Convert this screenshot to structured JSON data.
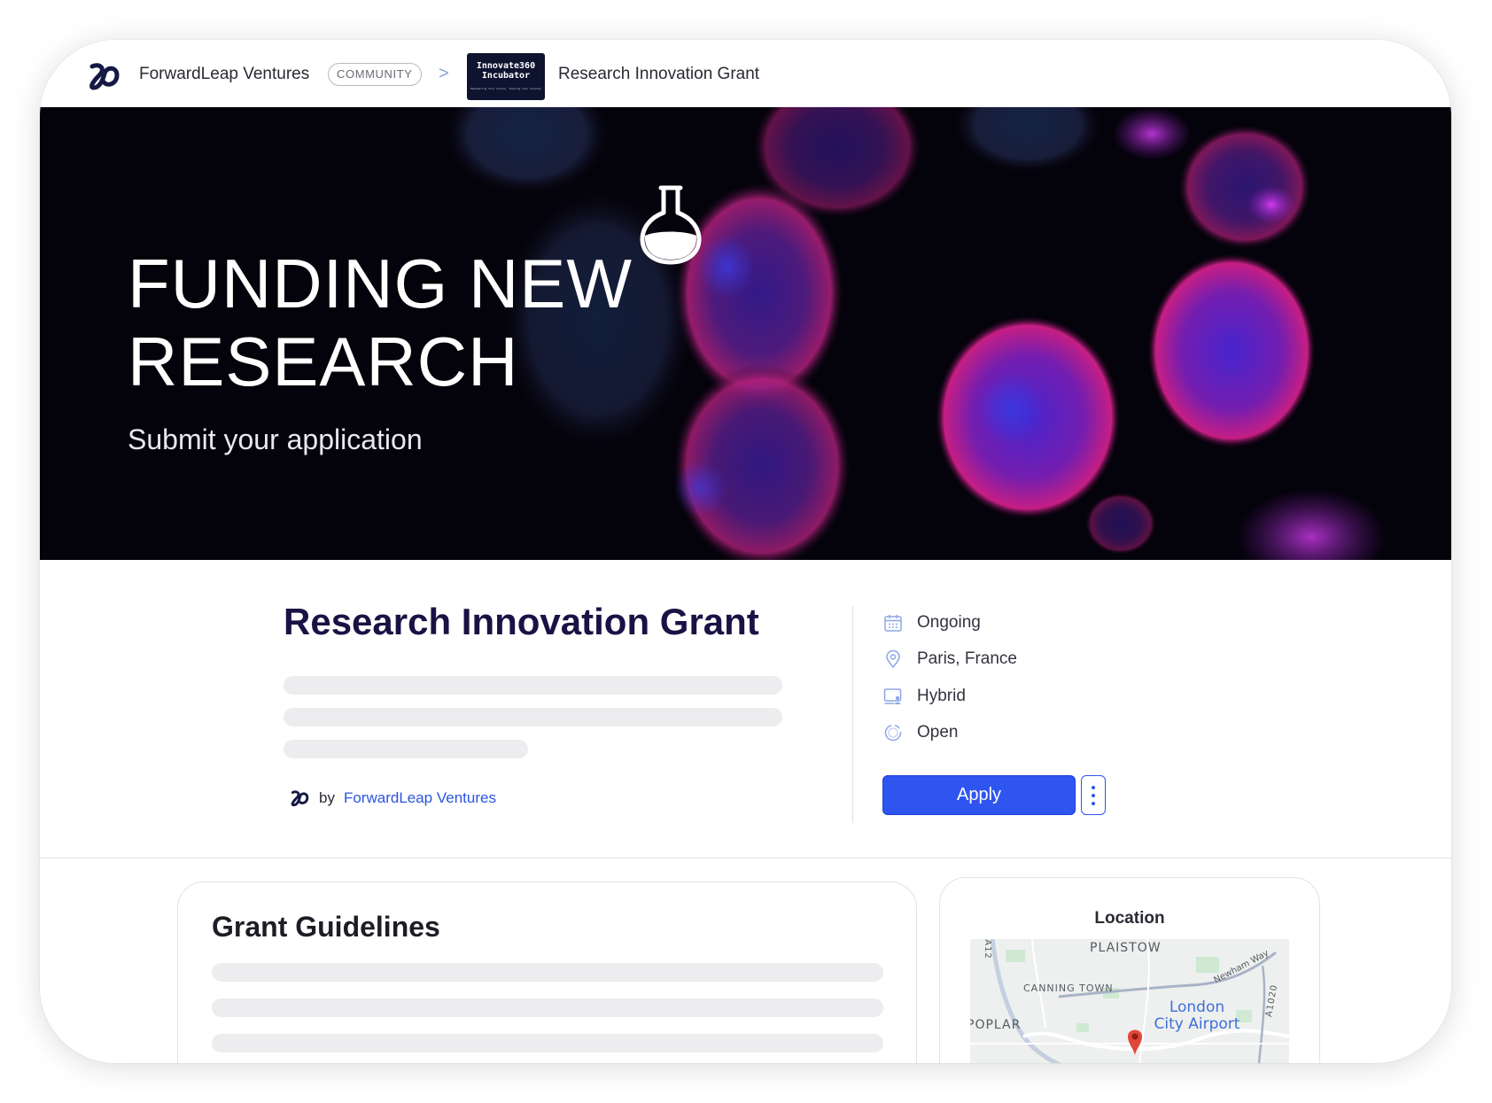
{
  "topbar": {
    "org_name": "ForwardLeap Ventures",
    "community_badge": "COMMUNITY",
    "separator": ">",
    "incubator_logo_line1": "Innovate360",
    "incubator_logo_line2": "Incubator",
    "incubator_logo_tagline": "Empowering Your Vision, Fueling Your Journey",
    "current_page": "Research Innovation Grant"
  },
  "hero": {
    "title": "FUNDING NEW RESEARCH",
    "subtitle": "Submit your application",
    "icon": "flask-icon"
  },
  "grant": {
    "title": "Research Innovation Grant",
    "by_label": "by",
    "organizer": "ForwardLeap Ventures"
  },
  "meta": {
    "status": "Ongoing",
    "location": "Paris, France",
    "format": "Hybrid",
    "availability": "Open",
    "icons": [
      "calendar-icon",
      "map-pin-icon",
      "hybrid-icon",
      "open-status-icon"
    ]
  },
  "actions": {
    "apply_label": "Apply"
  },
  "guidelines": {
    "title": "Grant Guidelines"
  },
  "location_card": {
    "title": "Location",
    "map_labels": {
      "plaistow": "PLAISTOW",
      "canning_town": "CANNING TOWN",
      "poplar": "POPLAR",
      "airport": "London City Airport",
      "newham_way": "Newham Way",
      "a12": "A12",
      "a1020": "A1020"
    }
  },
  "colors": {
    "accent": "#2f55f0",
    "title_navy": "#1c1145",
    "hero_bg": "#04020a",
    "link": "#2b55e0"
  }
}
